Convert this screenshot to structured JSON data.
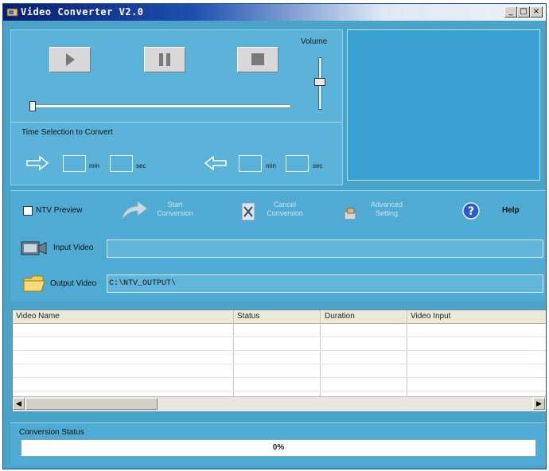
{
  "window": {
    "title": "Video Converter V2.0",
    "minimize": "_",
    "maximize": "□",
    "close": "×"
  },
  "player": {
    "volume_label": "Volume",
    "volume_level": 0.5,
    "seek_position": 0,
    "time_selection_label": "Time Selection to Convert",
    "start": {
      "min_label": "min",
      "sec_label": "sec",
      "min_value": "",
      "sec_value": ""
    },
    "end": {
      "min_label": "min",
      "sec_label": "sec",
      "min_value": "",
      "sec_value": ""
    }
  },
  "actions": {
    "ntv_preview": "NTV Preview",
    "start_conversion": "Start\nConversion",
    "cancel_conversion": "Cancel\nConversion",
    "advanced_setting": "Advanced\nSetting",
    "help": "Help"
  },
  "io": {
    "input_label": "Input Video",
    "input_value": "",
    "output_label": "Output Video",
    "output_value": "C:\\NTV_OUTPUT\\"
  },
  "table": {
    "columns": [
      "Video Name",
      "Status",
      "Duration",
      "Video Input"
    ],
    "rows": []
  },
  "status": {
    "label": "Conversion Status",
    "progress_text": "0%",
    "progress": 0
  },
  "colors": {
    "window_bg": "#4aa3c9",
    "accent": "#1d4fb0"
  }
}
